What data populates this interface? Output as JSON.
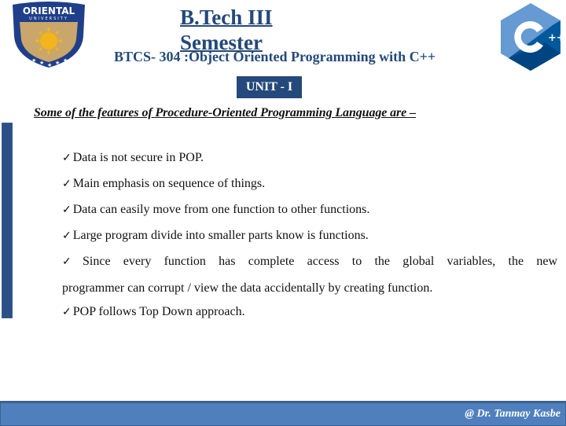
{
  "header": {
    "logo_left": {
      "name": "Oriental University",
      "line1": "ORIENTAL",
      "line2": "UNIVERSITY"
    },
    "title_lines": [
      "B.Tech III",
      "Semester"
    ],
    "subtitle": "BTCS- 304 :Object Oriented Programming with C++",
    "logo_right": {
      "name": "C++",
      "glyph": "C",
      "suffix": "++"
    }
  },
  "unit_badge": "UNIT - I",
  "section_heading": "Some of the features of Procedure-Oriented Programming Language are –",
  "bullet_icon": "✓",
  "bullets": [
    "Data is not secure in POP.",
    "Main emphasis on sequence of things.",
    "Data can easily move from one function to other functions.",
    "Large program divide into smaller parts know is functions.",
    "Since every function has complete access to the global variables, the new",
    "programmer can corrupt / view the data accidentally by creating function.",
    "POP follows Top Down approach."
  ],
  "footer": {
    "credit": "@ Dr. Tanmay Kasbe"
  },
  "colors": {
    "primary": "#24497a",
    "footer_bg": "#4f80bd",
    "left_bar": "#2a5087",
    "cpp_light": "#659ad2",
    "cpp_dark": "#00599c",
    "cpp_darker": "#004482",
    "shield_gold": "#c9a66b",
    "sun": "#f2b51c"
  }
}
